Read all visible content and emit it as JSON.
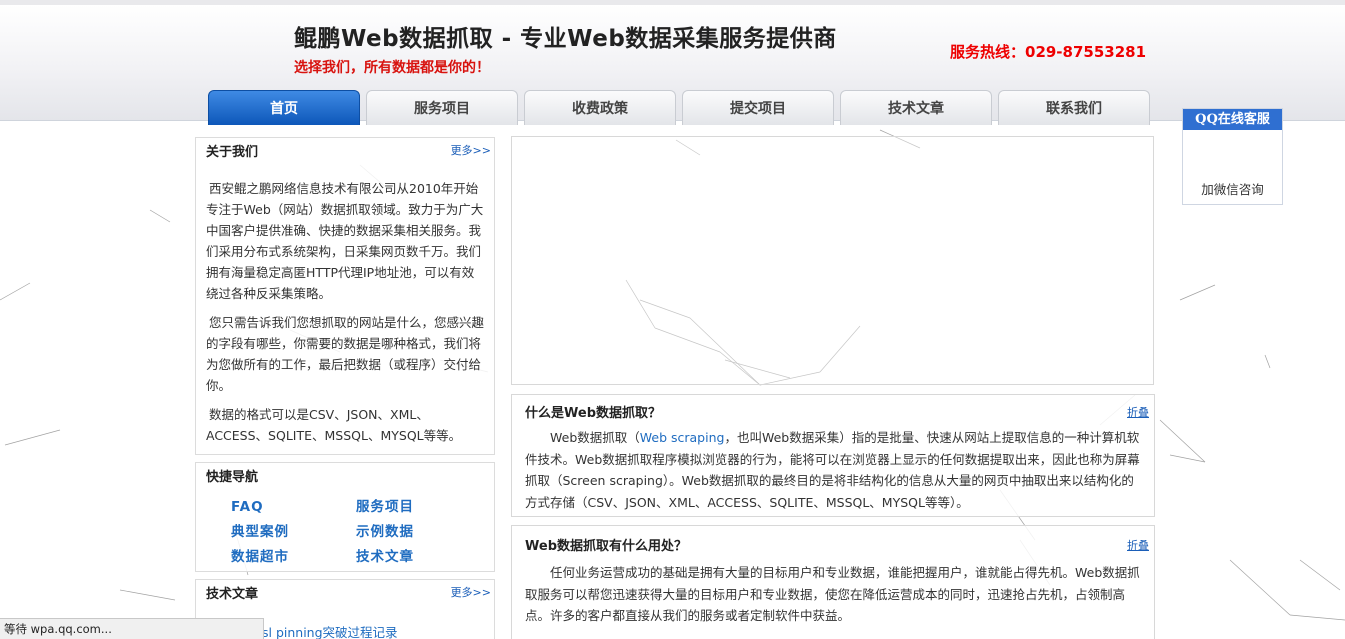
{
  "header": {
    "title": "鲲鹏Web数据抓取 - 专业Web数据采集服务提供商",
    "slogan": "选择我们，所有数据都是你的！",
    "hotline": "服务热线：029-87553281"
  },
  "nav": {
    "tabs": [
      {
        "label": "首页",
        "active": true
      },
      {
        "label": "服务项目"
      },
      {
        "label": "收费政策"
      },
      {
        "label": "提交项目"
      },
      {
        "label": "技术文章"
      },
      {
        "label": "联系我们"
      }
    ]
  },
  "about": {
    "title": "关于我们",
    "more": "更多>>",
    "paragraphs": [
      "西安鲲之鹏网络信息技术有限公司从2010年开始专注于Web（网站）数据抓取领域。致力于为广大中国客户提供准确、快捷的数据采集相关服务。我们采用分布式系统架构，日采集网页数千万。我们拥有海量稳定高匿HTTP代理IP地址池，可以有效绕过各种反采集策略。",
      "您只需告诉我们您想抓取的网站是什么，您感兴趣的字段有哪些，你需要的数据是哪种格式，我们将为您做所有的工作，最后把数据（或程序）交付给你。",
      "数据的格式可以是CSV、JSON、XML、ACCESS、SQLITE、MSSQL、MYSQL等等。"
    ]
  },
  "quicknav": {
    "title": "快捷导航",
    "links": [
      "FAQ",
      "服务项目",
      "典型案例",
      "示例数据",
      "数据超市",
      "技术文章"
    ]
  },
  "tech": {
    "title": "技术文章",
    "more": "更多>>",
    "first_item": "sl pinning突破过程记录"
  },
  "sections": [
    {
      "title": "什么是Web数据抓取？",
      "fold": "折叠",
      "text_before": "Web数据抓取（",
      "keyword": "Web scraping",
      "text_after": "，也叫Web数据采集）指的是批量、快速从网站上提取信息的一种计算机软件技术。Web数据抓取程序模拟浏览器的行为，能将可以在浏览器上显示的任何数据提取出来，因此也称为屏幕抓取（Screen scraping）。Web数据抓取的最终目的是将非结构化的信息从大量的网页中抽取出来以结构化的方式存储（CSV、JSON、XML、ACCESS、SQLITE、MSSQL、MYSQL等等）。"
    },
    {
      "title": "Web数据抓取有什么用处？",
      "fold": "折叠",
      "text": "任何业务运营成功的基础是拥有大量的目标用户和专业数据，谁能把握用户，谁就能占得先机。Web数据抓取服务可以帮您迅速获得大量的目标用户和专业数据，使您在降低运营成本的同时，迅速抢占先机，占领制高点。许多的客户都直接从我们的服务或者定制软件中获益。"
    }
  ],
  "qq_widget": {
    "title": "QQ在线客服",
    "wechat": "加微信咨询"
  },
  "statusbar": {
    "text": "等待 wpa.qq.com..."
  },
  "colors": {
    "nav_active": "#0d57b9",
    "hotline": "#e00000",
    "slogan": "#d8130f",
    "link": "#1f6cc0",
    "qq_header": "#2f6fd1"
  }
}
